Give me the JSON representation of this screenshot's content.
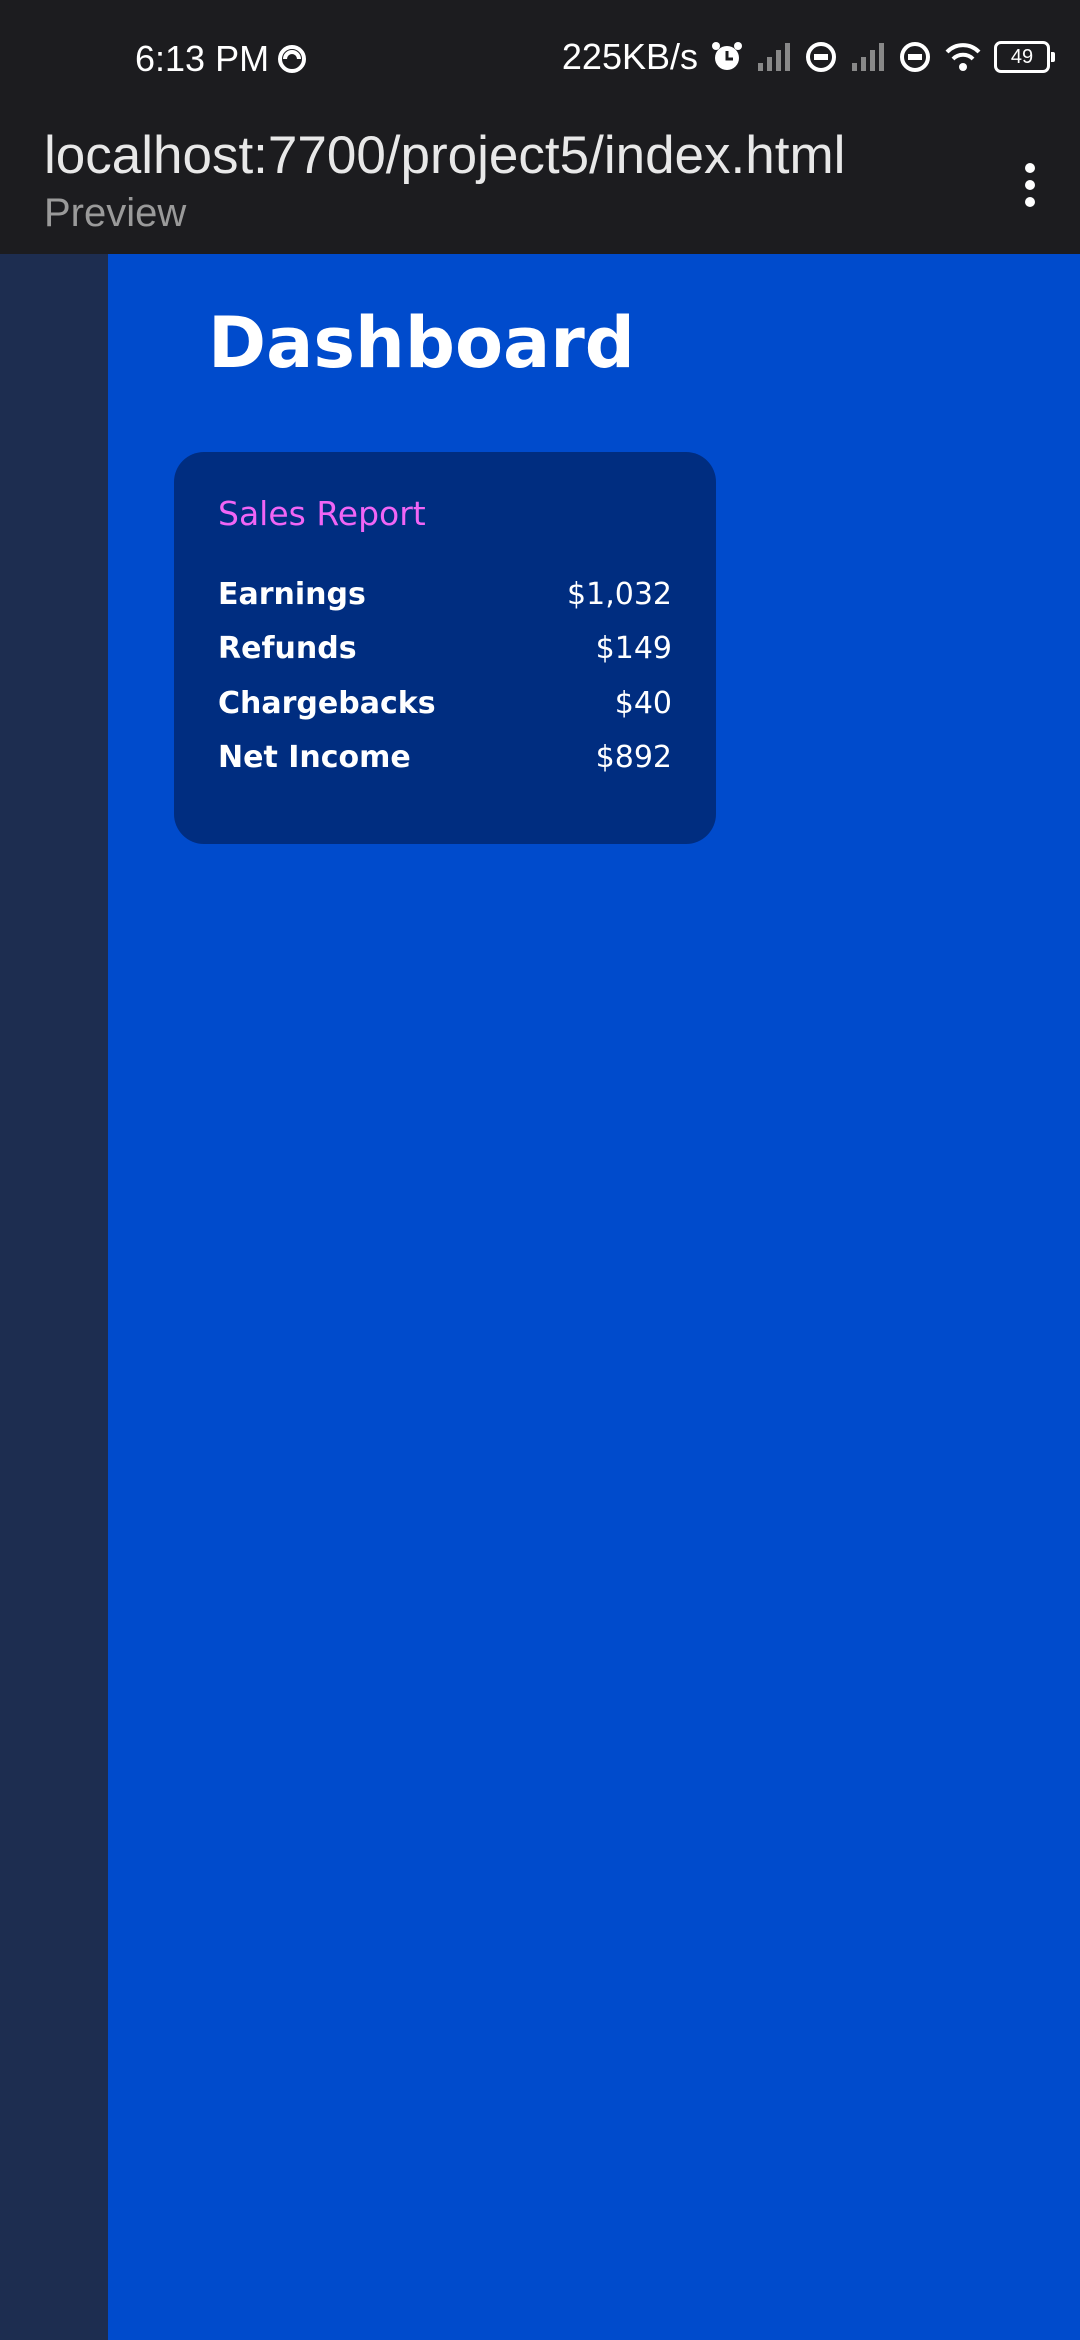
{
  "status_bar": {
    "time": "6:13 PM",
    "network_speed": "225KB/s",
    "battery_level": "49",
    "icons": [
      "sync-icon",
      "alarm-icon",
      "signal-icon",
      "hotspot-icon",
      "signal-icon",
      "hotspot-icon",
      "wifi-icon",
      "battery-icon"
    ]
  },
  "browser": {
    "url": "localhost:7700/project5/index.html",
    "subtitle": "Preview"
  },
  "page": {
    "title": "Dashboard"
  },
  "sales_report": {
    "title": "Sales Report",
    "rows": [
      {
        "label": "Earnings",
        "value": "$1,032"
      },
      {
        "label": "Refunds",
        "value": "$149"
      },
      {
        "label": "Chargebacks",
        "value": "$40"
      },
      {
        "label": "Net Income",
        "value": "$892"
      }
    ]
  },
  "colors": {
    "main_bg": "#004bcc",
    "sidebar_bg": "#1d2d50",
    "card_bg": "#002d80",
    "card_title": "#f065f5",
    "system_bar_bg": "#1c1c1f"
  }
}
